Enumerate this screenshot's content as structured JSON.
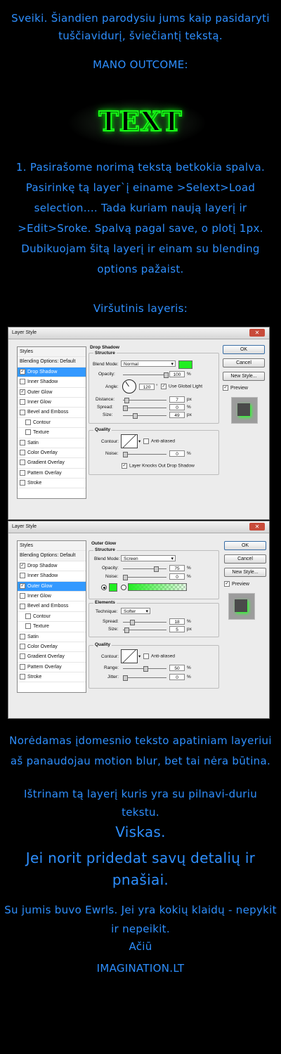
{
  "intro": "Sveiki. Šiandien parodysiu jums kaip pasidaryti tuščiavidurį, šviečiantį tekstą.",
  "outcome_label": "MANO OUTCOME:",
  "neon_text": "TEXT",
  "step1": "1. Pasirašome norimą tekstą betkokia spalva. Pasirinkę tą layer`į einame >Selext>Load selection.... Tada kuriam naują layerį ir >Edit>Sroke. Spalvą pagal save, o plotį 1px. Dubikuojam šitą layerį ir einam su blending options pažaist.",
  "upper_layer": "Viršutinis layeris:",
  "after1": "Norėdamas įdomesnio teksto apatiniam layeriui aš panaudojau motion blur, bet tai nėra būtina.",
  "after2": "Ištrinam tą layerį kuris yra su pilnavi-duriu tekstu.",
  "done": "Viskas.",
  "extra": "Jei norit pridedat savų detalių ir pnašiai.",
  "credits": "Su jumis buvo Ewrls. Jei yra kokių klaidų - nepykit ir nepeikit.",
  "thanks": "Ačiū",
  "site": "IMAGINATION.LT",
  "colors": {
    "text_blue": "#2e8fff",
    "neon_green": "#17ff17",
    "bg": "#000000"
  },
  "dialog1": {
    "title": "Layer Style",
    "list": [
      "Styles",
      "Blending Options: Default",
      "Drop Shadow",
      "Inner Shadow",
      "Outer Glow",
      "Inner Glow",
      "Bevel and Emboss",
      "Contour",
      "Texture",
      "Satin",
      "Color Overlay",
      "Gradient Overlay",
      "Pattern Overlay",
      "Stroke"
    ],
    "selected": "Drop Shadow",
    "buttons": {
      "ok": "OK",
      "cancel": "Cancel",
      "new_style": "New Style...",
      "preview": "Preview"
    },
    "section": "Drop Shadow",
    "structure": "Structure",
    "blend_mode_label": "Blend Mode:",
    "blend_mode": "Normal",
    "opacity_label": "Opacity:",
    "opacity": "100",
    "angle_label": "Angle:",
    "angle": "120",
    "global_light": "Use Global Light",
    "distance_label": "Distance:",
    "distance": "7",
    "spread_label": "Spread:",
    "spread": "0",
    "size_label": "Size:",
    "size": "49",
    "quality": "Quality",
    "contour_label": "Contour:",
    "anti_aliased": "Anti-aliased",
    "noise_label": "Noise:",
    "noise": "0",
    "knockout": "Layer Knocks Out Drop Shadow",
    "px": "px",
    "pct": "%",
    "deg": "°"
  },
  "dialog2": {
    "title": "Layer Style",
    "list": [
      "Styles",
      "Blending Options: Default",
      "Drop Shadow",
      "Inner Shadow",
      "Outer Glow",
      "Inner Glow",
      "Bevel and Emboss",
      "Contour",
      "Texture",
      "Satin",
      "Color Overlay",
      "Gradient Overlay",
      "Pattern Overlay",
      "Stroke"
    ],
    "selected": "Outer Glow",
    "buttons": {
      "ok": "OK",
      "cancel": "Cancel",
      "new_style": "New Style...",
      "preview": "Preview"
    },
    "section": "Outer Glow",
    "structure": "Structure",
    "blend_mode_label": "Blend Mode:",
    "blend_mode": "Screen",
    "opacity_label": "Opacity:",
    "opacity": "75",
    "noise_label": "Noise:",
    "noise": "0",
    "elements": "Elements",
    "technique_label": "Technique:",
    "technique": "Softer",
    "spread_label": "Spread:",
    "spread": "18",
    "size_label": "Size:",
    "size": "5",
    "quality": "Quality",
    "contour_label": "Contour:",
    "anti_aliased": "Anti-aliased",
    "range_label": "Range:",
    "range": "50",
    "jitter_label": "Jitter:",
    "jitter": "0",
    "px": "px",
    "pct": "%"
  }
}
